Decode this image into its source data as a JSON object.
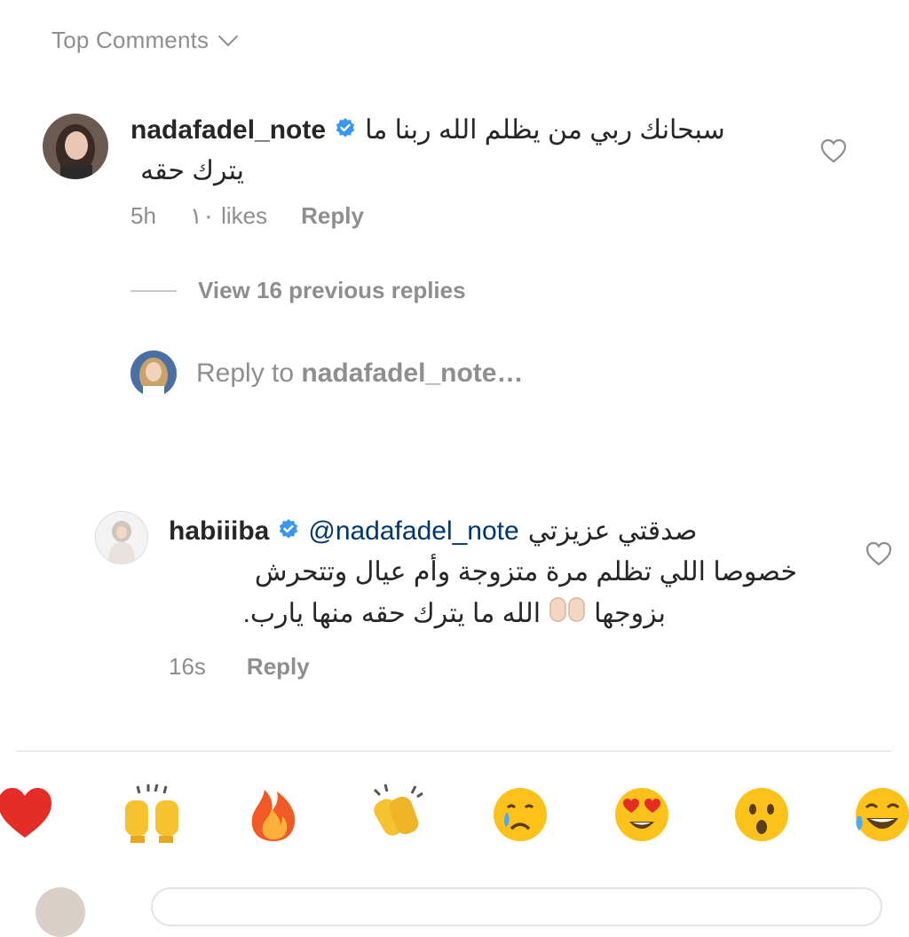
{
  "header": {
    "label": "Top Comments"
  },
  "comment1": {
    "username": "nadafadel_note",
    "text_line1": "سبحانك ربي من يظلم الله ربنا ما",
    "text_line2": "يترك حقه",
    "time": "5h",
    "likes": "١٠ likes",
    "reply": "Reply"
  },
  "view_replies": {
    "label": "View 16 previous replies"
  },
  "reply_to": {
    "prefix": "Reply to ",
    "username": "nadafadel_note…"
  },
  "comment2": {
    "username": "habiiiba",
    "mention": "@nadafadel_note",
    "text_line1": "صدقتي عزيزتي",
    "text_line2": "خصوصا اللي تظلم مرة متزوجة وأم عيال وتتحرش",
    "text_line3_a": "بزوجها",
    "text_line3_b": "الله ما يترك حقه منها يارب.",
    "time": "16s",
    "reply": "Reply"
  },
  "emoji_bar": {
    "items": [
      "red-heart",
      "raising-hands",
      "fire",
      "clapping-hands",
      "crying-face",
      "heart-eyes",
      "astonished-face",
      "laughing-tears"
    ]
  },
  "colors": {
    "text": "#262626",
    "muted": "#8e8e8e",
    "verified": "#3897f0",
    "link": "#00376b"
  }
}
